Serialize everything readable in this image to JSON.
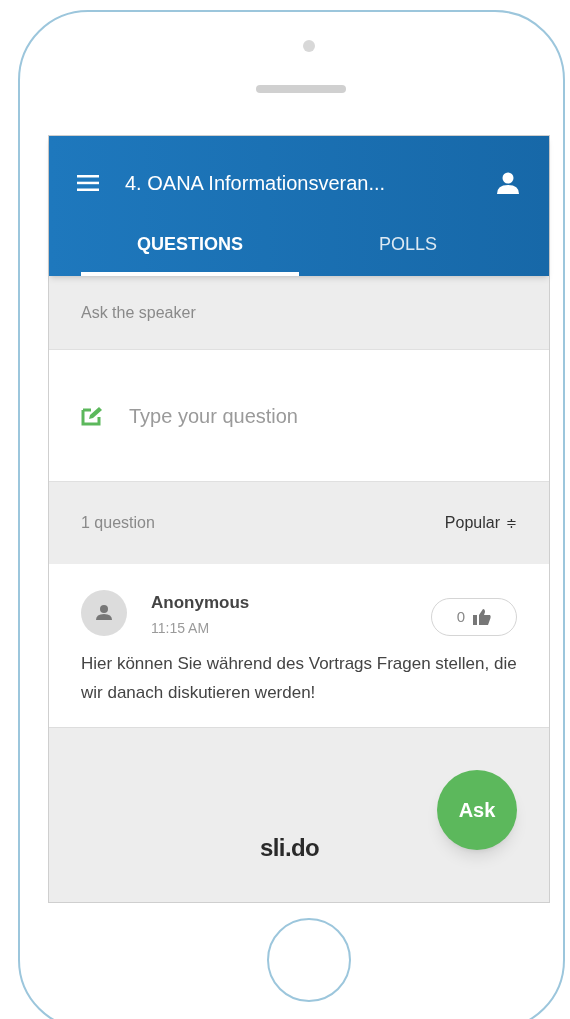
{
  "header": {
    "title": "4. OANA Informationsveran..."
  },
  "tabs": [
    {
      "label": "QUESTIONS",
      "selected": true
    },
    {
      "label": "POLLS",
      "selected": false
    }
  ],
  "ask_section": {
    "heading": "Ask the speaker",
    "placeholder": "Type your question"
  },
  "list_header": {
    "count": "1 question",
    "sort": "Popular",
    "sort_icon": "≑"
  },
  "questions": [
    {
      "author": "Anonymous",
      "time": "11:15 AM",
      "likes": "0",
      "text": "Hier können Sie während des Vortrags Fragen stellen, die wir danach diskutieren werden!"
    }
  ],
  "ask_button": "Ask",
  "logo": "sli.do"
}
